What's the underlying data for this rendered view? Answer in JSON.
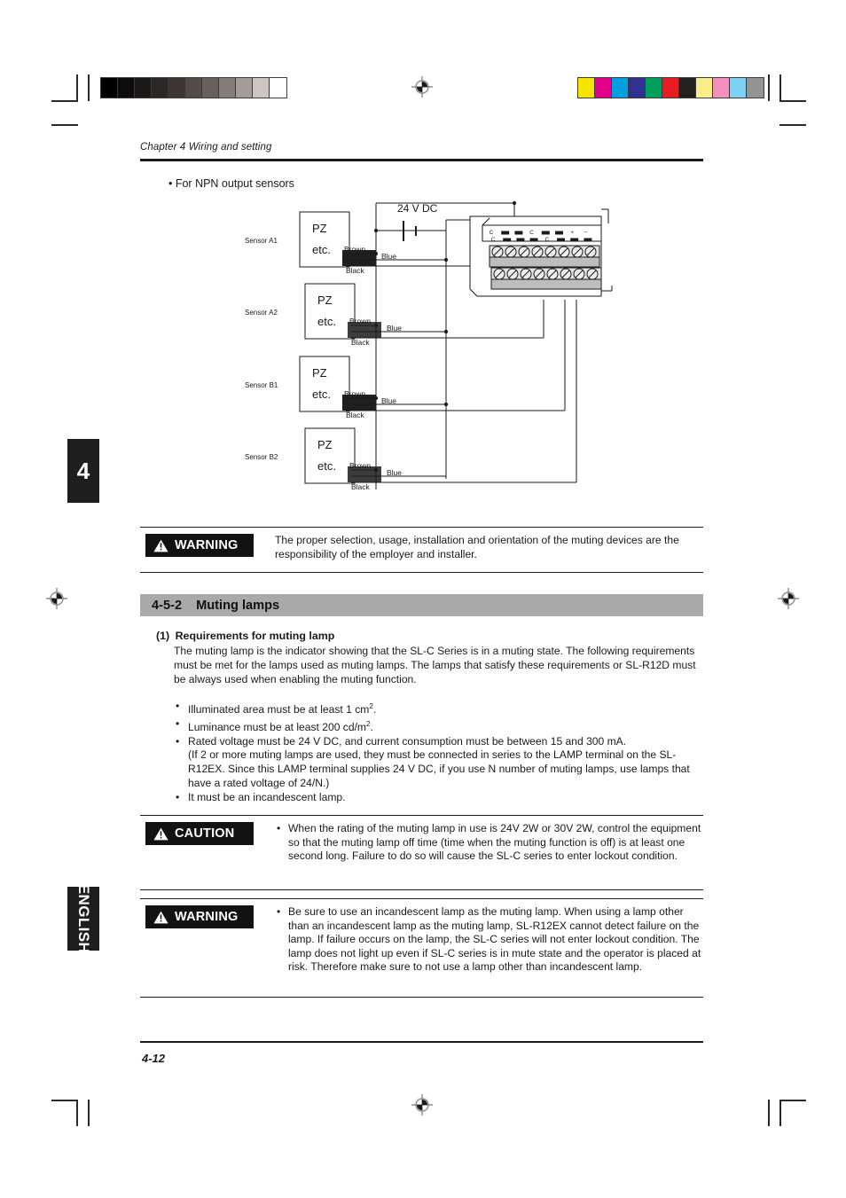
{
  "print_marks": {
    "gray_wedge": [
      "#000000",
      "#0d0b0b",
      "#1b1818",
      "#2b2727",
      "#3b3534",
      "#534b49",
      "#67605d",
      "#857d7a",
      "#a59c99",
      "#cdc5c2",
      "#ffffff"
    ],
    "color_bar": [
      "#f5e400",
      "#e5008c",
      "#00a0e0",
      "#2e3192",
      "#00a05a",
      "#e81c23",
      "#232020",
      "#f9ed8a",
      "#f48fc0",
      "#7dd2f3",
      "#949494"
    ],
    "registration_icon": "registration-target-icon"
  },
  "tabs": {
    "chapter_number": "4",
    "language": "ENGLISH"
  },
  "header": {
    "chapter_title": "Chapter 4  Wiring and setting"
  },
  "diagram": {
    "caption": "• For NPN output sensors",
    "supply_label": "24 V DC",
    "sensors": [
      {
        "name": "Sensor A1",
        "box_line1": "PZ",
        "box_line2": "etc.",
        "wires": [
          "Brown",
          "Blue",
          "Black"
        ]
      },
      {
        "name": "Sensor A2",
        "box_line1": "PZ",
        "box_line2": "etc.",
        "wires": [
          "Brown",
          "Blue",
          "Black"
        ]
      },
      {
        "name": "Sensor B1",
        "box_line1": "PZ",
        "box_line2": "etc.",
        "wires": [
          "Brown",
          "Blue",
          "Black"
        ]
      },
      {
        "name": "Sensor B2",
        "box_line1": "PZ",
        "box_line2": "etc.",
        "wires": [
          "Brown",
          "Blue",
          "Black"
        ]
      }
    ],
    "terminal_block": {
      "top_row_marks": [
        "C",
        "▬",
        "▬",
        "C",
        "▬",
        "▬",
        "+",
        "−"
      ],
      "bottom_row_marks": [
        "C",
        "▬",
        "▬",
        "▬",
        "C",
        "▬",
        "▬",
        "▬"
      ],
      "screw_count_per_row": 8,
      "icon": "screw-terminal-icon"
    }
  },
  "warning_top": {
    "label": "WARNING",
    "icon": "warning-triangle-icon",
    "text": "The proper selection, usage, installation and orientation of the muting devices are the responsibility of the employer and installer."
  },
  "section": {
    "number": "4-5-2",
    "title": "Muting lamps"
  },
  "requirements": {
    "heading_number": "(1)",
    "heading_text": "Requirements for muting lamp",
    "paragraph": "The muting lamp is the indicator showing that the SL-C Series is in a muting state. The following requirements must be met for the lamps used as muting lamps. The lamps that satisfy these requirements or SL-R12D must be always used when enabling the muting function.",
    "bullets": [
      {
        "main": "Illuminated area must be at least 1 cm²."
      },
      {
        "main": "Luminance must be at least 200 cd/m²."
      },
      {
        "main": "Rated voltage must be 24 V DC, and current consumption must be between 15 and 300 mA.",
        "cont": "(If 2 or more muting lamps are used, they must be connected in series to the LAMP terminal on the SL-R12EX. Since this LAMP terminal supplies 24 V DC, if you use N number of muting lamps, use lamps that have a rated voltage of 24/N.)"
      },
      {
        "main": "It must be an incandescent lamp."
      }
    ]
  },
  "caution": {
    "label": "CAUTION",
    "icon": "caution-triangle-icon",
    "bullets": [
      "When the rating of the muting lamp in use is 24V 2W or 30V 2W, control the equipment so that the muting lamp off time (time when the muting function is off) is at least one second long. Failure to do so will cause the SL-C series to enter lockout condition."
    ]
  },
  "warning_bottom": {
    "label": "WARNING",
    "icon": "warning-triangle-icon",
    "bullets": [
      "Be sure to use an incandescent lamp as the muting lamp. When using a lamp other than an incandescent lamp as the muting lamp, SL-R12EX cannot detect failure on the lamp. If failure occurs on the lamp, the SL-C series will not enter lockout condition. The lamp does not light up even if SL-C series is in mute state and the operator is placed at risk. Therefore make sure to not use a lamp other than incandescent lamp."
    ]
  },
  "footer": {
    "page_number": "4-12"
  }
}
